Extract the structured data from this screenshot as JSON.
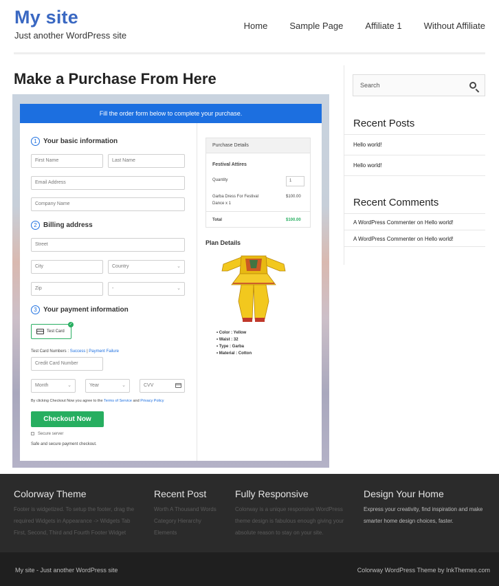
{
  "site": {
    "title": "My site",
    "tagline": "Just another WordPress site"
  },
  "nav": {
    "items": [
      "Home",
      "Sample Page",
      "Affiliate 1",
      "Without Affiliate"
    ]
  },
  "page": {
    "heading": "Make a Purchase From Here"
  },
  "form": {
    "banner": "Fill the order form below to complete your purchase.",
    "steps": [
      {
        "num": "1",
        "label": "Your basic information"
      },
      {
        "num": "2",
        "label": "Billing address"
      },
      {
        "num": "3",
        "label": "Your payment information"
      }
    ],
    "placeholders": {
      "first_name": "First Name",
      "last_name": "Last Name",
      "email": "Email Address",
      "company": "Company Name",
      "street": "Street",
      "city": "City",
      "country": "Country",
      "zip": "Zip",
      "state": "-",
      "card_number": "Credit Card Number",
      "month": "Month",
      "year": "Year",
      "cvv": "CVV"
    },
    "test_card_label": "Test Card",
    "test_numbers_prefix": "Test Card Numbers :",
    "test_numbers_success": "Success",
    "test_numbers_sep": "|",
    "test_numbers_failure": "Payment Failure",
    "terms_prefix": "By clicking Checkout Now you agree to the",
    "terms_link": "Terms of Service",
    "terms_and": "and",
    "privacy_link": "Privacy Policy",
    "checkout_label": "Checkout Now",
    "secure_label": "Secure server",
    "safe_label": "Safe and secure payment checkout.",
    "colors": {
      "banner": "#1c6fe0",
      "button": "#27ae60"
    }
  },
  "purchase": {
    "header": "Purchase Details",
    "product": "Festival Attires",
    "quantity_label": "Quantity",
    "quantity_value": "1",
    "item_line1": "Garba Dress For Festival",
    "item_line2": "Dance x 1",
    "item_price": "$100.00",
    "total_label": "Total",
    "total_value": "$100.00"
  },
  "plan": {
    "title": "Plan Details",
    "attributes": [
      "Color : Yellow",
      "Waist : 32",
      "Type : Garba",
      "Material  : Cotton"
    ]
  },
  "sidebar": {
    "search_placeholder": "Search",
    "recent_posts_title": "Recent Posts",
    "recent_posts": [
      "Hello world!",
      "Hello world!"
    ],
    "recent_comments_title": "Recent Comments",
    "recent_comments": [
      "A WordPress Commenter on Hello world!",
      "A WordPress Commenter on Hello world!"
    ]
  },
  "footer": {
    "columns": [
      {
        "title": "Colorway Theme",
        "lines": [
          "Footer is widgetized. To setup the footer, drag the",
          "required Widgets in Appearance -> Widgets Tab",
          "First, Second, Third and Fourth Footer Widget"
        ]
      },
      {
        "title": "Recent Post",
        "lines": [
          "Worth A Thousand Words",
          "Category Hierarchy",
          "Elements"
        ]
      },
      {
        "title": "Fully Responsive",
        "lines": [
          "Colorway is a unique responsive WordPress",
          "theme design is fabulous enough giving your",
          "absolute reason to stay on your site."
        ]
      },
      {
        "title": "Design Your Home",
        "lines": [
          "Express your creativity, find inspiration and make",
          "smarter home design choices, faster."
        ]
      }
    ],
    "bottom_left": "My site - Just another WordPress site",
    "bottom_right": "Colorway WordPress Theme by InkThemes.com"
  }
}
